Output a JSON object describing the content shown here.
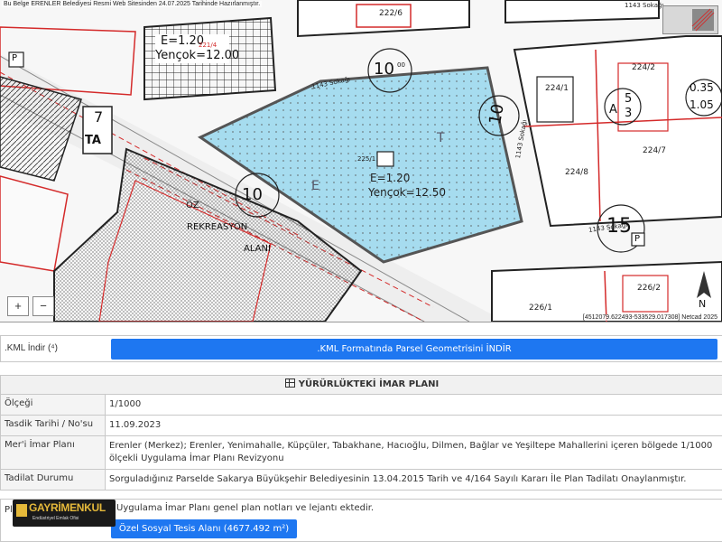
{
  "map": {
    "banner": "Bu Belge ERENLER Belediyesi Resmi Web Sitesinden 24.07.2025 Tarihinde Hazırlanmıştır.",
    "banner_sub": "4512079.622493",
    "coords": "[4512079.622493-533529.017308] Netcad 2025",
    "zoom_in": "+",
    "zoom_out": "−",
    "labels": {
      "e_top": "E=1.20",
      "yencok_top": "Yençok=12.00",
      "e_main": "E=1.20",
      "yencok_main": "Yençok=12.50",
      "parcel_main": "225/1",
      "road_1143_a": "1143 Sokağı",
      "road_1143_b": "1143 Sokağı",
      "road_1143_c": "1143 Sokağı",
      "road_1143_d": "1143 Sokağı",
      "circle_10_a": "10",
      "circle_10_b": "10",
      "circle_10_c": "10",
      "circle_15": "15",
      "sup_00": "00",
      "p_a": "P",
      "p_b": "P",
      "ta": "TA",
      "seven": "7",
      "p224_2": "224/2",
      "p224_1": "224/1",
      "p224_7": "224/7",
      "p224_8": "224/8",
      "p222_6": "222/6",
      "p226_2": "226/2",
      "p226_1": "226/1",
      "p221_4": "221/4",
      "a_5_3": "A",
      "five_3": "5",
      "three": "3",
      "fr_035": "0.35",
      "fr_105": "1.05",
      "oz": "ÖZ",
      "rekreasyon": "REKREASYON",
      "alani": "ALANI",
      "north": "N",
      "e_letter": "E",
      "t_letter": "T"
    }
  },
  "kml": {
    "label": ".KML İndir (⁴)",
    "button": ".KML Formatında Parsel Geometrisini İNDİR"
  },
  "plan": {
    "header": "YÜRÜRLÜKTEKİ İMAR PLANI",
    "rows": [
      {
        "label": "Ölçeği",
        "value": "1/1000"
      },
      {
        "label": "Tasdik Tarihi / No'su",
        "value": "11.09.2023"
      },
      {
        "label": "Mer'i İmar Planı",
        "value": "Erenler (Merkez); Erenler, Yenimahalle, Küpçüler, Tabakhane, Hacıoğlu, Dilmen, Bağlar ve Yeşiltepe Mahallerini içeren bölgede 1/1000 ölçekli Uygulama İmar Planı Revizyonu"
      },
      {
        "label": "Tadilat Durumu",
        "value": "Sorguladığınız Parselde Sakarya Büyükşehir Belediyesinin 13.04.2015 Tarih ve 4/164 Sayılı Kararı İle Plan Tadilatı Onaylanmıştır."
      }
    ]
  },
  "notes": {
    "label": "Pl",
    "text": "Uygulama İmar Planı genel plan notları ve lejantı ektedir.",
    "button": "Özel Sosyal Tesis Alanı (4677.492 m²)"
  },
  "logo": {
    "name": "GAYRİMENKUL",
    "sub": "Endüstriyel Emlak Ofisi"
  },
  "colors": {
    "accent": "#1e77f1",
    "parcel_fill": "#a6dcef",
    "plan_red": "#d42a2a"
  }
}
